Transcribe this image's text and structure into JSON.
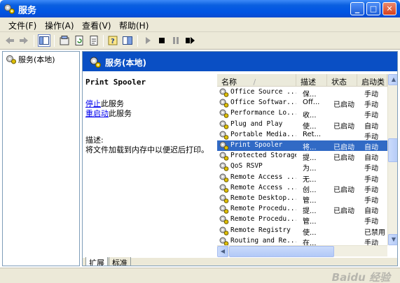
{
  "window": {
    "title": "服务",
    "min_symbol": "_",
    "max_symbol": "□",
    "close_symbol": "✕"
  },
  "menu": [
    "文件(F)",
    "操作(A)",
    "查看(V)",
    "帮助(H)"
  ],
  "toolbar_icons": [
    "back-arrow-icon",
    "forward-arrow-icon",
    "show-hide-tree-icon",
    "properties-icon",
    "refresh-icon",
    "export-list-icon",
    "help-icon",
    "console-icon",
    "play-icon",
    "stop-icon",
    "pause-icon",
    "restart-icon"
  ],
  "tree": {
    "root_label": "服务(本地)"
  },
  "pane": {
    "header_title": "服务(本地)"
  },
  "detail": {
    "service_name": "Print Spooler",
    "stop_link": "停止",
    "stop_suffix": "此服务",
    "restart_link": "重启动",
    "restart_suffix": "此服务",
    "desc_label": "描述:",
    "desc_text": "将文件加载到内存中以便迟后打印。"
  },
  "columns": [
    "名称",
    "描述",
    "状态",
    "启动类"
  ],
  "services": [
    {
      "name": "Office Source ...",
      "desc": "保...",
      "status": "",
      "startup": "手动"
    },
    {
      "name": "Office Softwar...",
      "desc": "Off...",
      "status": "已启动",
      "startup": "手动"
    },
    {
      "name": "Performance Lo...",
      "desc": "收...",
      "status": "",
      "startup": "手动"
    },
    {
      "name": "Plug and Play",
      "desc": "使...",
      "status": "已启动",
      "startup": "自动"
    },
    {
      "name": "Portable Media...",
      "desc": "Ret...",
      "status": "",
      "startup": "手动"
    },
    {
      "name": "Print Spooler",
      "desc": "将...",
      "status": "已启动",
      "startup": "自动",
      "selected": true
    },
    {
      "name": "Protected Storage",
      "desc": "提...",
      "status": "已启动",
      "startup": "自动"
    },
    {
      "name": "QoS RSVP",
      "desc": "为...",
      "status": "",
      "startup": "手动"
    },
    {
      "name": "Remote Access ...",
      "desc": "无...",
      "status": "",
      "startup": "手动"
    },
    {
      "name": "Remote Access ...",
      "desc": "创...",
      "status": "已启动",
      "startup": "手动"
    },
    {
      "name": "Remote Desktop...",
      "desc": "管...",
      "status": "",
      "startup": "手动"
    },
    {
      "name": "Remote Procedu...",
      "desc": "提...",
      "status": "已启动",
      "startup": "自动"
    },
    {
      "name": "Remote Procedu...",
      "desc": "管...",
      "status": "",
      "startup": "手动"
    },
    {
      "name": "Remote Registry",
      "desc": "使...",
      "status": "",
      "startup": "已禁用"
    },
    {
      "name": "Routing and Re...",
      "desc": "在...",
      "status": "",
      "startup": "手动"
    }
  ],
  "tabs": [
    "扩展",
    "标准"
  ],
  "watermark": "Baidu 经验",
  "colors": {
    "title_blue": "#0054e3",
    "header_blue": "#0a4fc4",
    "selection": "#316ac5",
    "chrome": "#ece9d8"
  }
}
